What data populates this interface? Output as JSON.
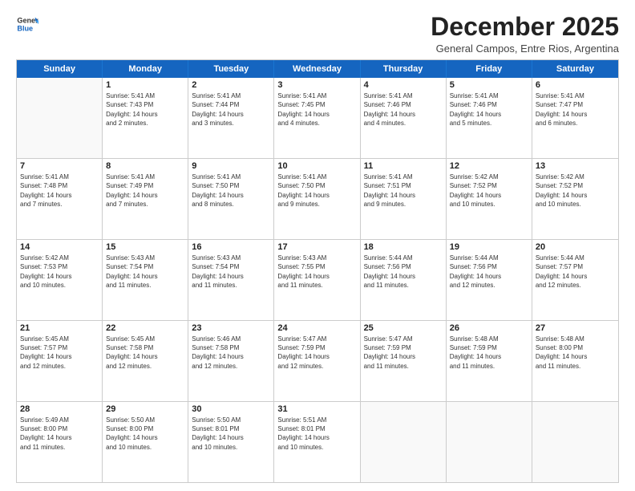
{
  "logo": {
    "line1": "General",
    "line2": "Blue"
  },
  "title": "December 2025",
  "subtitle": "General Campos, Entre Rios, Argentina",
  "headers": [
    "Sunday",
    "Monday",
    "Tuesday",
    "Wednesday",
    "Thursday",
    "Friday",
    "Saturday"
  ],
  "weeks": [
    [
      {
        "day": "",
        "info": ""
      },
      {
        "day": "1",
        "info": "Sunrise: 5:41 AM\nSunset: 7:43 PM\nDaylight: 14 hours\nand 2 minutes."
      },
      {
        "day": "2",
        "info": "Sunrise: 5:41 AM\nSunset: 7:44 PM\nDaylight: 14 hours\nand 3 minutes."
      },
      {
        "day": "3",
        "info": "Sunrise: 5:41 AM\nSunset: 7:45 PM\nDaylight: 14 hours\nand 4 minutes."
      },
      {
        "day": "4",
        "info": "Sunrise: 5:41 AM\nSunset: 7:46 PM\nDaylight: 14 hours\nand 4 minutes."
      },
      {
        "day": "5",
        "info": "Sunrise: 5:41 AM\nSunset: 7:46 PM\nDaylight: 14 hours\nand 5 minutes."
      },
      {
        "day": "6",
        "info": "Sunrise: 5:41 AM\nSunset: 7:47 PM\nDaylight: 14 hours\nand 6 minutes."
      }
    ],
    [
      {
        "day": "7",
        "info": "Sunrise: 5:41 AM\nSunset: 7:48 PM\nDaylight: 14 hours\nand 7 minutes."
      },
      {
        "day": "8",
        "info": "Sunrise: 5:41 AM\nSunset: 7:49 PM\nDaylight: 14 hours\nand 7 minutes."
      },
      {
        "day": "9",
        "info": "Sunrise: 5:41 AM\nSunset: 7:50 PM\nDaylight: 14 hours\nand 8 minutes."
      },
      {
        "day": "10",
        "info": "Sunrise: 5:41 AM\nSunset: 7:50 PM\nDaylight: 14 hours\nand 9 minutes."
      },
      {
        "day": "11",
        "info": "Sunrise: 5:41 AM\nSunset: 7:51 PM\nDaylight: 14 hours\nand 9 minutes."
      },
      {
        "day": "12",
        "info": "Sunrise: 5:42 AM\nSunset: 7:52 PM\nDaylight: 14 hours\nand 10 minutes."
      },
      {
        "day": "13",
        "info": "Sunrise: 5:42 AM\nSunset: 7:52 PM\nDaylight: 14 hours\nand 10 minutes."
      }
    ],
    [
      {
        "day": "14",
        "info": "Sunrise: 5:42 AM\nSunset: 7:53 PM\nDaylight: 14 hours\nand 10 minutes."
      },
      {
        "day": "15",
        "info": "Sunrise: 5:43 AM\nSunset: 7:54 PM\nDaylight: 14 hours\nand 11 minutes."
      },
      {
        "day": "16",
        "info": "Sunrise: 5:43 AM\nSunset: 7:54 PM\nDaylight: 14 hours\nand 11 minutes."
      },
      {
        "day": "17",
        "info": "Sunrise: 5:43 AM\nSunset: 7:55 PM\nDaylight: 14 hours\nand 11 minutes."
      },
      {
        "day": "18",
        "info": "Sunrise: 5:44 AM\nSunset: 7:56 PM\nDaylight: 14 hours\nand 11 minutes."
      },
      {
        "day": "19",
        "info": "Sunrise: 5:44 AM\nSunset: 7:56 PM\nDaylight: 14 hours\nand 12 minutes."
      },
      {
        "day": "20",
        "info": "Sunrise: 5:44 AM\nSunset: 7:57 PM\nDaylight: 14 hours\nand 12 minutes."
      }
    ],
    [
      {
        "day": "21",
        "info": "Sunrise: 5:45 AM\nSunset: 7:57 PM\nDaylight: 14 hours\nand 12 minutes."
      },
      {
        "day": "22",
        "info": "Sunrise: 5:45 AM\nSunset: 7:58 PM\nDaylight: 14 hours\nand 12 minutes."
      },
      {
        "day": "23",
        "info": "Sunrise: 5:46 AM\nSunset: 7:58 PM\nDaylight: 14 hours\nand 12 minutes."
      },
      {
        "day": "24",
        "info": "Sunrise: 5:47 AM\nSunset: 7:59 PM\nDaylight: 14 hours\nand 12 minutes."
      },
      {
        "day": "25",
        "info": "Sunrise: 5:47 AM\nSunset: 7:59 PM\nDaylight: 14 hours\nand 11 minutes."
      },
      {
        "day": "26",
        "info": "Sunrise: 5:48 AM\nSunset: 7:59 PM\nDaylight: 14 hours\nand 11 minutes."
      },
      {
        "day": "27",
        "info": "Sunrise: 5:48 AM\nSunset: 8:00 PM\nDaylight: 14 hours\nand 11 minutes."
      }
    ],
    [
      {
        "day": "28",
        "info": "Sunrise: 5:49 AM\nSunset: 8:00 PM\nDaylight: 14 hours\nand 11 minutes."
      },
      {
        "day": "29",
        "info": "Sunrise: 5:50 AM\nSunset: 8:00 PM\nDaylight: 14 hours\nand 10 minutes."
      },
      {
        "day": "30",
        "info": "Sunrise: 5:50 AM\nSunset: 8:01 PM\nDaylight: 14 hours\nand 10 minutes."
      },
      {
        "day": "31",
        "info": "Sunrise: 5:51 AM\nSunset: 8:01 PM\nDaylight: 14 hours\nand 10 minutes."
      },
      {
        "day": "",
        "info": ""
      },
      {
        "day": "",
        "info": ""
      },
      {
        "day": "",
        "info": ""
      }
    ]
  ]
}
